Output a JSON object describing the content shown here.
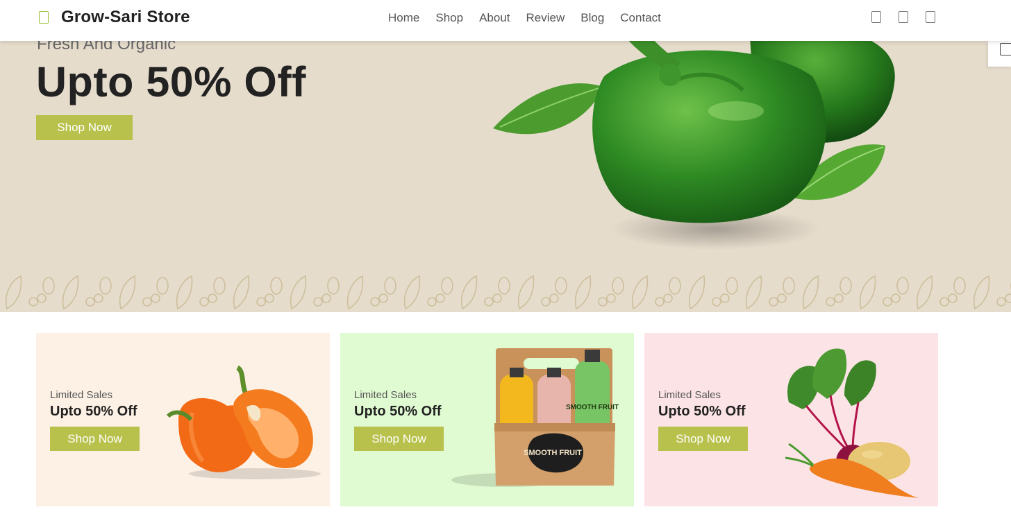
{
  "brand": {
    "name": "Grow-Sari Store",
    "logo_icon": "store-icon",
    "accent": "#b9c14d"
  },
  "nav": {
    "items": [
      {
        "label": "Home"
      },
      {
        "label": "Shop"
      },
      {
        "label": "About"
      },
      {
        "label": "Review"
      },
      {
        "label": "Blog"
      },
      {
        "label": "Contact"
      }
    ]
  },
  "header_icons": [
    "menu-icon",
    "cart-icon",
    "user-icon"
  ],
  "hero": {
    "subtitle": "Fresh And Organic",
    "title": "Upto 50% Off",
    "button": "Shop Now",
    "background": "#e6dccc"
  },
  "banners": [
    {
      "subtitle": "Limited Sales",
      "title": "Upto 50% Off",
      "button": "Shop Now",
      "background": "#fdf1e5"
    },
    {
      "subtitle": "Limited Sales",
      "title": "Upto 50% Off",
      "button": "Shop Now",
      "background": "#e0fbd2",
      "label": "SMOOTH FRUIT"
    },
    {
      "subtitle": "Limited Sales",
      "title": "Upto 50% Off",
      "button": "Shop Now",
      "background": "#fce4e6"
    }
  ]
}
